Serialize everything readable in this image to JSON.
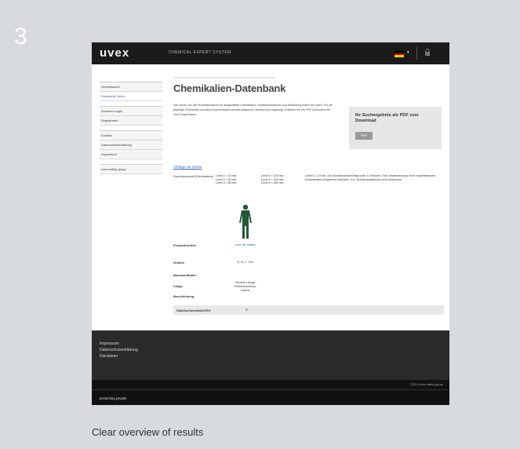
{
  "step_number": "3",
  "caption": "Clear overview of results",
  "screenshot": {
    "header": {
      "logo": "uvex",
      "title": "CHEMICAL EXPERT SYSTEM",
      "language_flag_colors": [
        "#000000",
        "#dd0000",
        "#ffce00"
      ],
      "caret": "▾",
      "account_icon": "lock-icon"
    },
    "sidebar": {
      "group1": [
        "Schnellsuche",
        "Erweiterte Suche"
      ],
      "group2": [
        "Ansehen Login",
        "Registrieren"
      ],
      "group3": [
        "Kontakt",
        "Datenschutzerklärung",
        "Impressum"
      ],
      "group4": [
        "uvex safety group"
      ]
    },
    "main": {
      "title": "Chemikalien-Datenbank",
      "intro": "Hier sehen Sie die Permeationslevel für ausgewählte Chemikalien. Detailinformationen und Einstufung finden Sie unten. Für die jeweilige Chemikalie und deren Konzentration werden passende Handschuhe angezeigt. Erstellen Sie ein PDF-Dokument mit Ihren Ergebnissen.",
      "pdf_box": {
        "title": "Ihr Suchergebnis als PDF zum Download",
        "button": "PDF"
      },
      "section_link": "Anfrage zur Suche",
      "durability_label": "Durchbruchzeit (Permeation)",
      "levels_col1": [
        "Level 1 < 10 min",
        "Level 2 < 30 min",
        "Level 3 < 60 min"
      ],
      "levels_col2": [
        "Level 4 < 120 min",
        "Level 5 < 240 min",
        "Level 6 < 480 min"
      ],
      "levels_desc": "Level 0 < 10 min: Die Durchbruchszeit liegt unter 10 Minuten. Eine Verwendung ist nicht empfehlenswert. Konzentration eingehend beachten. n.d.: Schutzhandschuhe nicht untersucht.",
      "product_label": "Produkt/Artikel",
      "product_value": "uvex 3B classic",
      "properties": [
        {
          "key": "Größen",
          "value": "S, M, L, XXL"
        },
        {
          "key": "Baumwollfutter",
          "value": ""
        },
        {
          "key": "Länge",
          "value": "Flexible Länge, Reissverschluss, Haube"
        },
        {
          "key": "Beschichtung",
          "value": ""
        }
      ],
      "gray_row": {
        "key": "Sattelschutzmittel/GFX",
        "value": "0"
      }
    },
    "footer": {
      "links": [
        "Impressum",
        "Datenschutzerklärung",
        "Disclaimer"
      ],
      "copyright": "©2014 uvex safety group",
      "tagline": "protecting people"
    }
  }
}
